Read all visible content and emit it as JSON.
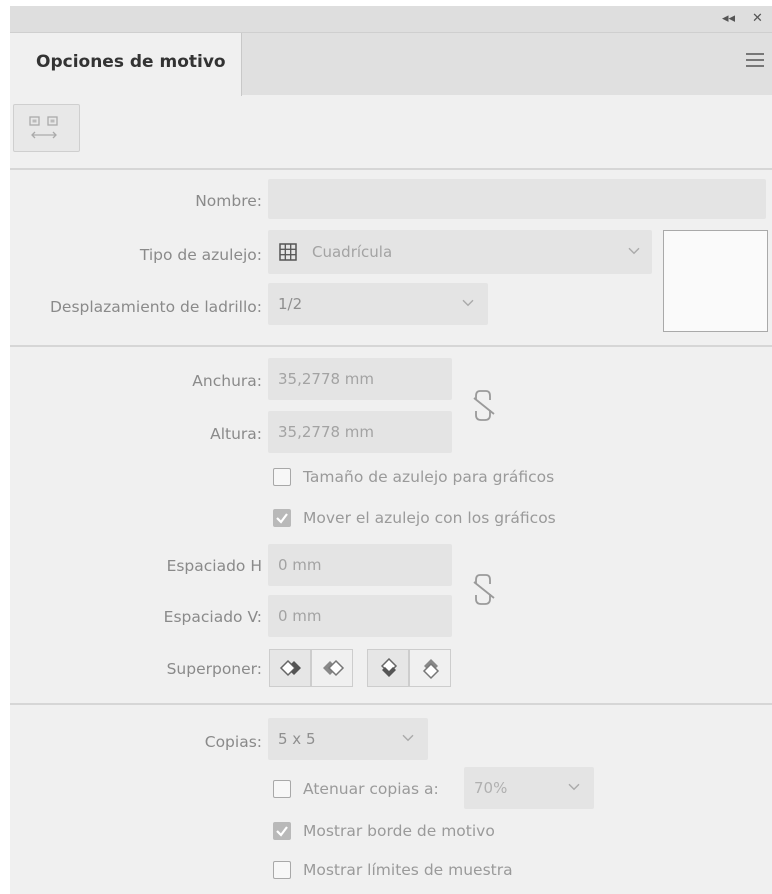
{
  "panel": {
    "title": "Opciones de motivo",
    "icons": {
      "collapse": "double-chevron-left-icon",
      "close": "close-icon",
      "menu": "hamburger-menu-icon",
      "tile_tool": "pattern-tile-tool-icon",
      "link_size": "broken-chain-link-icon",
      "link_spacing": "broken-chain-link-icon"
    },
    "buttons": {
      "collapse_glyph": "◂◂",
      "close_glyph": "✕"
    }
  },
  "labels": {
    "nombre": "Nombre:",
    "tipo": "Tipo de azulejo:",
    "desplazamiento": "Desplazamiento de ladrillo:",
    "anchura": "Anchura:",
    "altura": "Altura:",
    "espaciado_h": "Espaciado H",
    "espaciado_v": "Espaciado V:",
    "superponer": "Superponer:",
    "copias": "Copias:"
  },
  "fields": {
    "nombre": "",
    "tipo": "Cuadrícula",
    "desplazamiento": "1/2",
    "anchura": "35,2778 mm",
    "altura": "35,2778 mm",
    "espaciado_h": "0 mm",
    "espaciado_v": "0 mm",
    "copias": "5 x 5",
    "atenuar": "70%"
  },
  "checkboxes": {
    "tamano": {
      "label": "Tamaño de azulejo para gráficos",
      "checked": false
    },
    "mover": {
      "label": "Mover el azulejo con los gráficos",
      "checked": true
    },
    "atenuar": {
      "label": "Atenuar copias a:",
      "checked": false
    },
    "borde": {
      "label": "Mostrar borde de motivo",
      "checked": true
    },
    "limites": {
      "label": "Mostrar límites de muestra",
      "checked": false
    }
  },
  "colors": {
    "panel_bg": "#f0f0f0",
    "field_bg": "#e4e4e4",
    "label_text": "#8a8a8a"
  }
}
